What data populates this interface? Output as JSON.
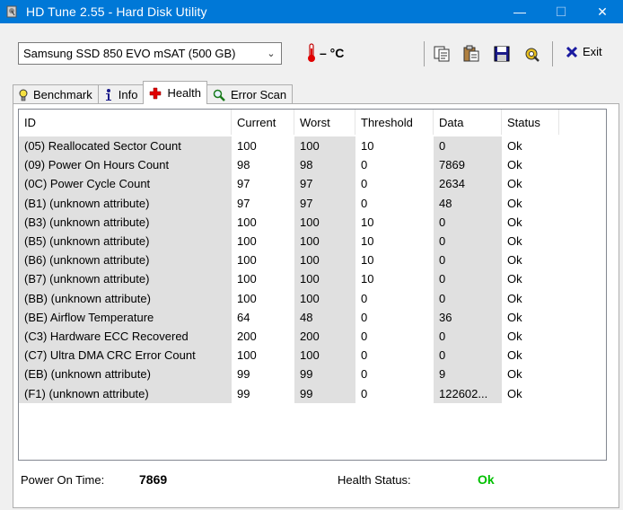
{
  "window": {
    "title": "HD Tune 2.55 - Hard Disk Utility",
    "minimize": "—",
    "maximize": "☐",
    "close": "✕"
  },
  "toolbar": {
    "drive": "Samsung SSD 850 EVO mSAT (500 GB)",
    "temperature": "– °C",
    "exit_label": "Exit"
  },
  "tabs": [
    {
      "label": "Benchmark",
      "icon": "lightbulb-icon"
    },
    {
      "label": "Info",
      "icon": "info-icon"
    },
    {
      "label": "Health",
      "icon": "health-cross-icon"
    },
    {
      "label": "Error Scan",
      "icon": "magnifier-icon"
    }
  ],
  "table": {
    "columns": [
      "ID",
      "Current",
      "Worst",
      "Threshold",
      "Data",
      "Status"
    ],
    "rows": [
      [
        "(05) Reallocated Sector Count",
        "100",
        "100",
        "10",
        "0",
        "Ok"
      ],
      [
        "(09) Power On Hours Count",
        "98",
        "98",
        "0",
        "7869",
        "Ok"
      ],
      [
        "(0C) Power Cycle Count",
        "97",
        "97",
        "0",
        "2634",
        "Ok"
      ],
      [
        "(B1) (unknown attribute)",
        "97",
        "97",
        "0",
        "48",
        "Ok"
      ],
      [
        "(B3) (unknown attribute)",
        "100",
        "100",
        "10",
        "0",
        "Ok"
      ],
      [
        "(B5) (unknown attribute)",
        "100",
        "100",
        "10",
        "0",
        "Ok"
      ],
      [
        "(B6) (unknown attribute)",
        "100",
        "100",
        "10",
        "0",
        "Ok"
      ],
      [
        "(B7) (unknown attribute)",
        "100",
        "100",
        "10",
        "0",
        "Ok"
      ],
      [
        "(BB) (unknown attribute)",
        "100",
        "100",
        "0",
        "0",
        "Ok"
      ],
      [
        "(BE) Airflow Temperature",
        "64",
        "48",
        "0",
        "36",
        "Ok"
      ],
      [
        "(C3) Hardware ECC Recovered",
        "200",
        "200",
        "0",
        "0",
        "Ok"
      ],
      [
        "(C7) Ultra DMA CRC Error Count",
        "100",
        "100",
        "0",
        "0",
        "Ok"
      ],
      [
        "(EB) (unknown attribute)",
        "99",
        "99",
        "0",
        "9",
        "Ok"
      ],
      [
        "(F1) (unknown attribute)",
        "99",
        "99",
        "0",
        "122602...",
        "Ok"
      ]
    ]
  },
  "footer": {
    "power_on_label": "Power On Time:",
    "power_on_value": "7869",
    "health_label": "Health Status:",
    "health_value": "Ok",
    "health_color": "#00c000"
  }
}
